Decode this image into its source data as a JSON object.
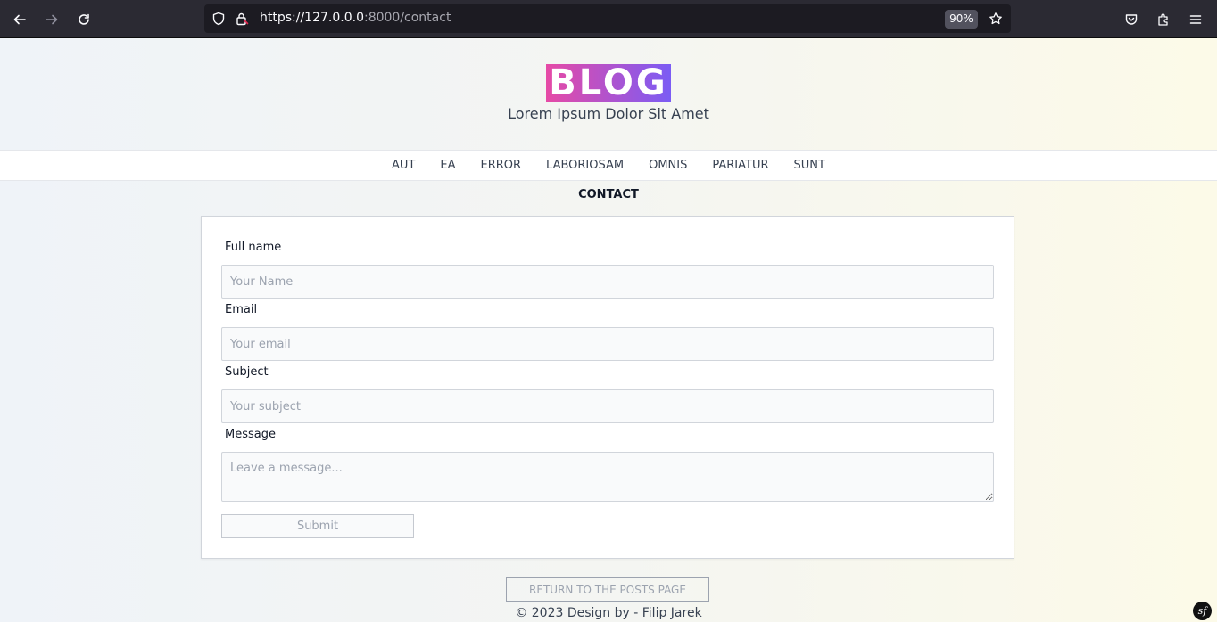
{
  "browser": {
    "url_host": "https://127.0.0.0",
    "url_rest": ":8000/contact",
    "zoom": "90%"
  },
  "header": {
    "logo": "BLOG",
    "tagline": "Lorem Ipsum Dolor Sit Amet"
  },
  "nav": {
    "items": [
      "AUT",
      "EA",
      "ERROR",
      "LABORIOSAM",
      "OMNIS",
      "PARIATUR",
      "SUNT"
    ]
  },
  "page_title": "CONTACT",
  "form": {
    "name_label": "Full name",
    "name_placeholder": "Your Name",
    "email_label": "Email",
    "email_placeholder": "Your email",
    "subject_label": "Subject",
    "subject_placeholder": "Your subject",
    "message_label": "Message",
    "message_placeholder": "Leave a message...",
    "submit_label": "Submit"
  },
  "return_label": "RETURN TO THE POSTS PAGE",
  "footer": "© 2023 Design by - Filip Jarek",
  "symfony_badge": "sf"
}
